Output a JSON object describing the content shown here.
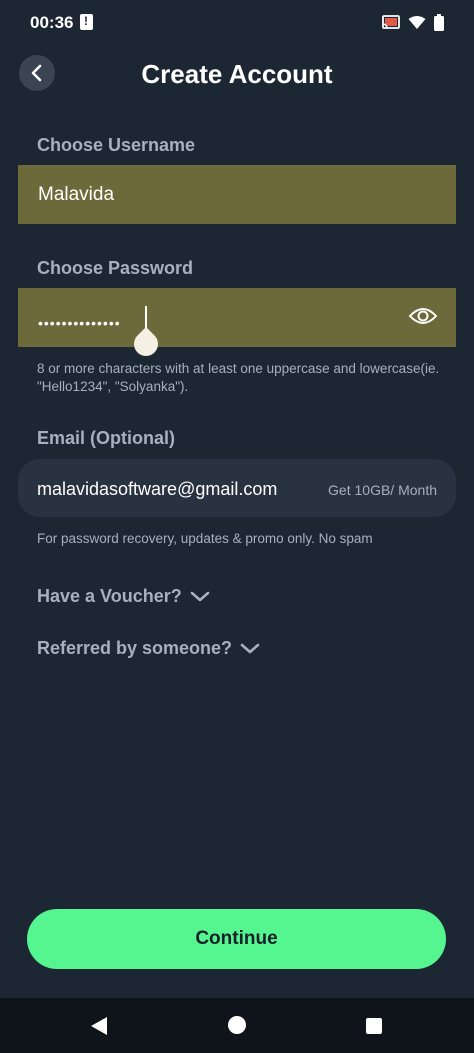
{
  "status_bar": {
    "time": "00:36",
    "icons": [
      "alert-notification-icon",
      "cast-icon",
      "wifi-icon",
      "battery-icon"
    ]
  },
  "header": {
    "title": "Create Account",
    "back_icon": "chevron-left-icon"
  },
  "username": {
    "label": "Choose Username",
    "value": "Malavida"
  },
  "password": {
    "label": "Choose Password",
    "masked_value": "••••••••••••••",
    "hint": "8 or more characters with at least one uppercase and lowercase(ie. \"Hello1234\", \"Solyanka\").",
    "toggle_icon": "eye-icon"
  },
  "email": {
    "label": "Email  (Optional)",
    "value": "malavidasoftware@gmail.com",
    "promo": "Get 10GB/ Month",
    "hint": "For password recovery, updates & promo only. No spam"
  },
  "voucher": {
    "label": "Have a Voucher?"
  },
  "referral": {
    "label": "Referred by someone?"
  },
  "continue": {
    "label": "Continue"
  },
  "colors": {
    "background": "#1d2633",
    "field_highlight": "#6c6a3b",
    "accent": "#55f58f",
    "muted_text": "#a8b0bc"
  }
}
